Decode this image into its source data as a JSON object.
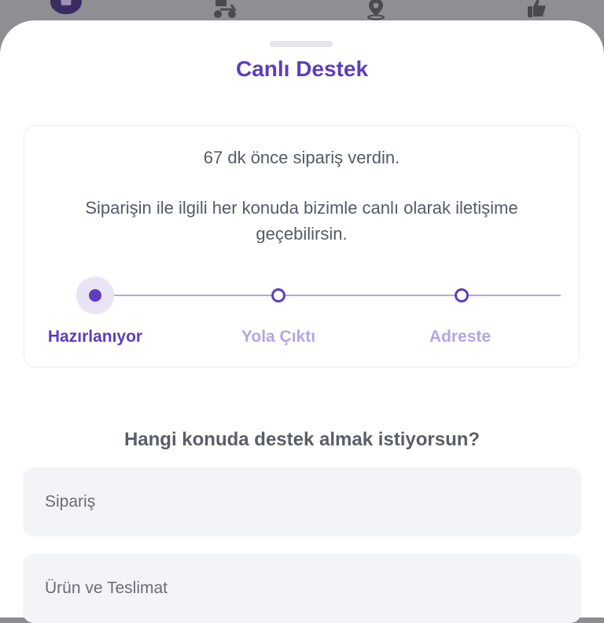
{
  "background_tabs": {
    "icons": [
      "bag-icon",
      "courier-scooter-icon",
      "location-pin-icon",
      "thumbs-up-icon"
    ]
  },
  "sheet": {
    "title": "Canlı Destek"
  },
  "status": {
    "elapsed_text": "67 dk önce sipariş verdin.",
    "info_text": "Siparişin ile ilgili her konuda bizimle canlı olarak iletişime geçebilirsin.",
    "steps": [
      {
        "label": "Hazırlanıyor",
        "active": true
      },
      {
        "label": "Yola Çıktı",
        "active": false
      },
      {
        "label": "Adreste",
        "active": false
      }
    ]
  },
  "support": {
    "question": "Hangi konuda destek almak istiyorsun?",
    "topics": [
      "Sipariş",
      "Ürün ve Teslimat"
    ]
  },
  "colors": {
    "brand_purple": "#5d3ebc",
    "inactive_step": "#b3a6e0",
    "text_gray": "#555a65",
    "option_bg": "#f3f4f7"
  }
}
